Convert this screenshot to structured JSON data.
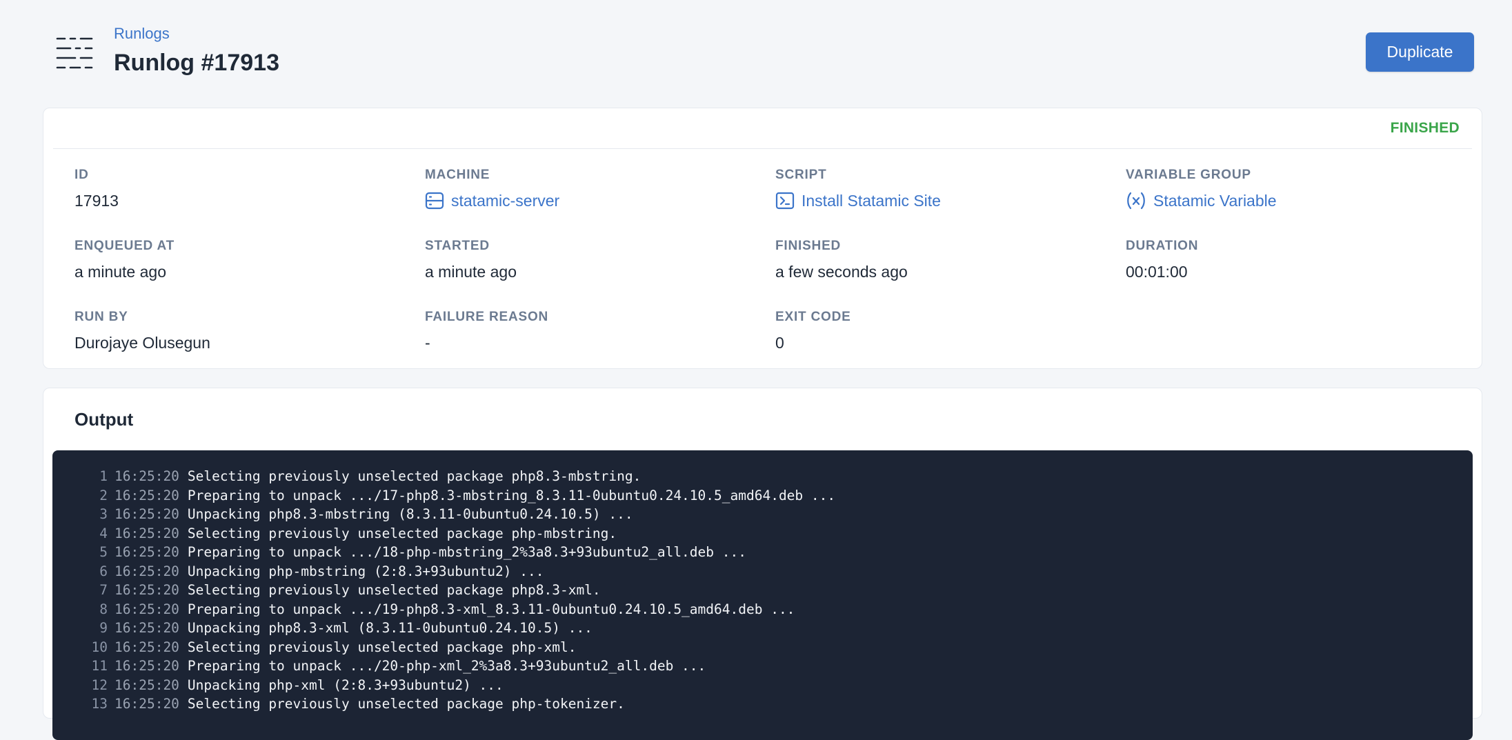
{
  "header": {
    "breadcrumb": "Runlogs",
    "title": "Runlog #17913",
    "duplicate_label": "Duplicate"
  },
  "details": {
    "status": "FINISHED",
    "fields": {
      "id": {
        "label": "ID",
        "value": "17913"
      },
      "machine": {
        "label": "MACHINE",
        "value": "statamic-server",
        "icon": "server-icon"
      },
      "script": {
        "label": "SCRIPT",
        "value": "Install Statamic Site",
        "icon": "terminal-icon"
      },
      "variable_group": {
        "label": "VARIABLE GROUP",
        "value": "Statamic Variable",
        "icon": "variable-icon"
      },
      "enqueued_at": {
        "label": "ENQUEUED AT",
        "value": "a minute ago"
      },
      "started": {
        "label": "STARTED",
        "value": "a minute ago"
      },
      "finished": {
        "label": "FINISHED",
        "value": "a few seconds ago"
      },
      "duration": {
        "label": "DURATION",
        "value": "00:01:00"
      },
      "run_by": {
        "label": "RUN BY",
        "value": "Durojaye Olusegun"
      },
      "failure_reason": {
        "label": "FAILURE REASON",
        "value": "-"
      },
      "exit_code": {
        "label": "EXIT CODE",
        "value": "0"
      }
    }
  },
  "output": {
    "title": "Output",
    "lines": [
      {
        "n": "1",
        "time": "16:25:20",
        "text": "Selecting previously unselected package php8.3-mbstring."
      },
      {
        "n": "2",
        "time": "16:25:20",
        "text": "Preparing to unpack .../17-php8.3-mbstring_8.3.11-0ubuntu0.24.10.5_amd64.deb ..."
      },
      {
        "n": "3",
        "time": "16:25:20",
        "text": "Unpacking php8.3-mbstring (8.3.11-0ubuntu0.24.10.5) ..."
      },
      {
        "n": "4",
        "time": "16:25:20",
        "text": "Selecting previously unselected package php-mbstring."
      },
      {
        "n": "5",
        "time": "16:25:20",
        "text": "Preparing to unpack .../18-php-mbstring_2%3a8.3+93ubuntu2_all.deb ..."
      },
      {
        "n": "6",
        "time": "16:25:20",
        "text": "Unpacking php-mbstring (2:8.3+93ubuntu2) ..."
      },
      {
        "n": "7",
        "time": "16:25:20",
        "text": "Selecting previously unselected package php8.3-xml."
      },
      {
        "n": "8",
        "time": "16:25:20",
        "text": "Preparing to unpack .../19-php8.3-xml_8.3.11-0ubuntu0.24.10.5_amd64.deb ..."
      },
      {
        "n": "9",
        "time": "16:25:20",
        "text": "Unpacking php8.3-xml (8.3.11-0ubuntu0.24.10.5) ..."
      },
      {
        "n": "10",
        "time": "16:25:20",
        "text": "Selecting previously unselected package php-xml."
      },
      {
        "n": "11",
        "time": "16:25:20",
        "text": "Preparing to unpack .../20-php-xml_2%3a8.3+93ubuntu2_all.deb ..."
      },
      {
        "n": "12",
        "time": "16:25:20",
        "text": "Unpacking php-xml (2:8.3+93ubuntu2) ..."
      },
      {
        "n": "13",
        "time": "16:25:20",
        "text": "Selecting previously unselected package php-tokenizer."
      }
    ]
  },
  "colors": {
    "accent": "#3b74c9",
    "status_finished": "#3aa54a",
    "terminal_bg": "#1c2434",
    "page_bg": "#f4f6f9"
  }
}
